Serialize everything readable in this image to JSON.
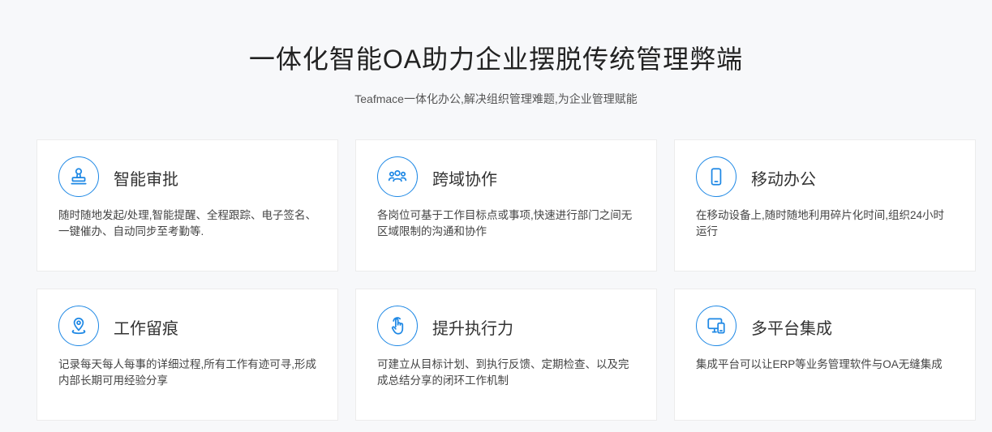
{
  "header": {
    "title": "一体化智能OA助力企业摆脱传统管理弊端",
    "subtitle": "Teafmace一体化办公,解决组织管理难题,为企业管理赋能"
  },
  "accent_color": "#1e88e5",
  "features": [
    {
      "title": "智能审批",
      "icon": "stamp-icon",
      "desc": "随时随地发起/处理,智能提醒、全程跟踪、电子签名、一键催办、自动同步至考勤等."
    },
    {
      "title": "跨域协作",
      "icon": "team-icon",
      "desc": "各岗位可基于工作目标点或事项,快速进行部门之间无区域限制的沟通和协作"
    },
    {
      "title": "移动办公",
      "icon": "mobile-icon",
      "desc": "在移动设备上,随时随地利用碎片化时间,组织24小时运行"
    },
    {
      "title": "工作留痕",
      "icon": "location-pin-icon",
      "desc": "记录每天每人每事的详细过程,所有工作有迹可寻,形成内部长期可用经验分享"
    },
    {
      "title": "提升执行力",
      "icon": "tap-hand-icon",
      "desc": "可建立从目标计划、到执行反馈、定期检查、以及完成总结分享的闭环工作机制"
    },
    {
      "title": "多平台集成",
      "icon": "multi-device-icon",
      "desc": "集成平台可以让ERP等业务管理软件与OA无缝集成"
    }
  ]
}
